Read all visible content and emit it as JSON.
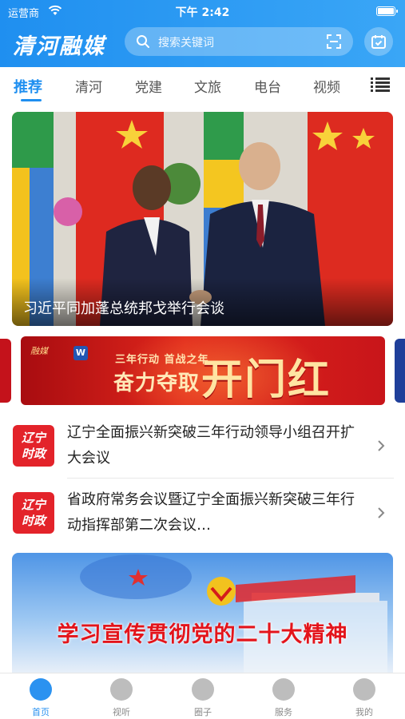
{
  "status_bar": {
    "carrier": "运营商",
    "time": "下午 2:42"
  },
  "header": {
    "logo_text": "清河融媒",
    "search_placeholder": "搜索关键词",
    "accent_color": "#1f8ff0"
  },
  "tabs": [
    {
      "label": "推荐",
      "active": true
    },
    {
      "label": "清河",
      "active": false
    },
    {
      "label": "党建",
      "active": false
    },
    {
      "label": "文旅",
      "active": false
    },
    {
      "label": "电台",
      "active": false
    },
    {
      "label": "视频",
      "active": false
    }
  ],
  "hero": {
    "caption": "习近平同加蓬总统邦戈举行会谈"
  },
  "banner": {
    "badge": "融媒",
    "subtitle": "三年行动 首战之年",
    "left_text": "奋力夺取",
    "right_text": "开门红"
  },
  "news": [
    {
      "thumb_line1": "辽宁",
      "thumb_line2": "时政",
      "title": "辽宁全面振兴新突破三年行动领导小组召开扩大会议"
    },
    {
      "thumb_line1": "辽宁",
      "thumb_line2": "时政",
      "title": "省政府常务会议暨辽宁全面振兴新突破三年行动指挥部第二次会议…"
    }
  ],
  "promo": {
    "slogan": "学习宣传贯彻党的二十大精神"
  },
  "tabbar": [
    {
      "label": "首页",
      "icon": "home-icon",
      "active": true
    },
    {
      "label": "视听",
      "icon": "play-icon",
      "active": false
    },
    {
      "label": "圈子",
      "icon": "circle-icon",
      "active": false
    },
    {
      "label": "服务",
      "icon": "service-icon",
      "active": false
    },
    {
      "label": "我的",
      "icon": "profile-icon",
      "active": false
    }
  ]
}
